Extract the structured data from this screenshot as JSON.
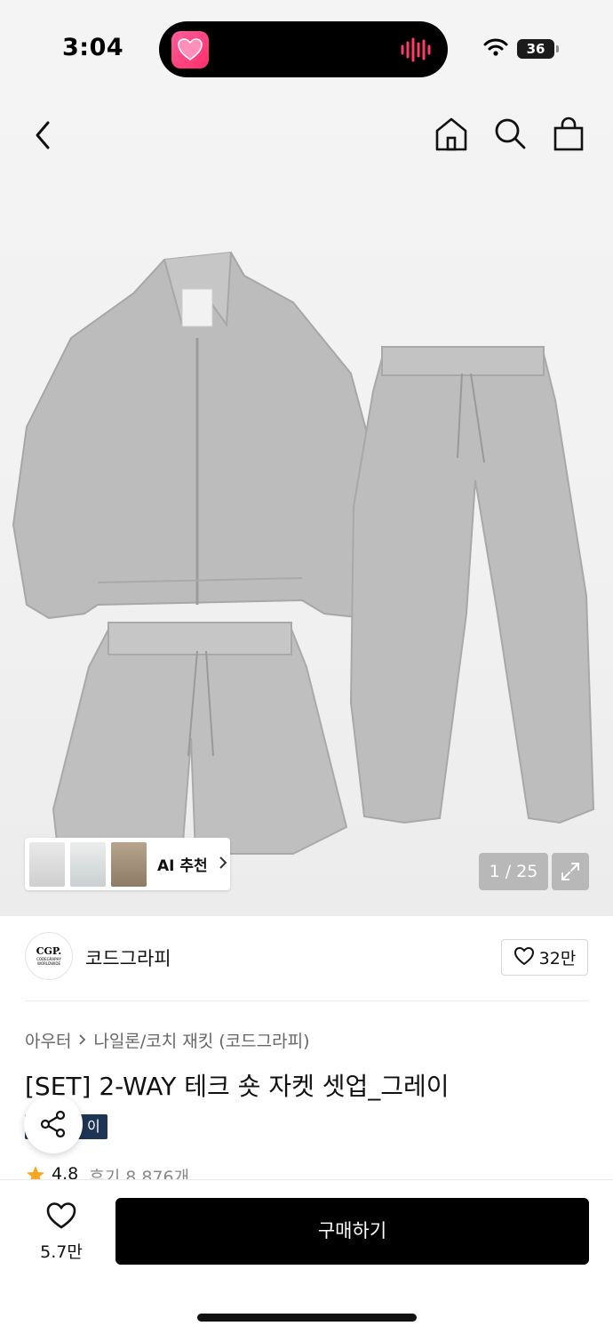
{
  "status_bar": {
    "time": "3:04",
    "battery": "36"
  },
  "image_gallery": {
    "counter": "1 / 25",
    "ai_label": "AI 추천"
  },
  "brand": {
    "logo_text": "CGP.",
    "logo_subtext": "CODEGRAPHY WORLDWIDE",
    "name": "코드그라피",
    "like_count": "32만"
  },
  "product": {
    "breadcrumb": [
      "아우터",
      "나일론/코치 재킷 (코드그라피)"
    ],
    "title": "[SET] 2-WAY 테크 숏 자켓 셋업_그레이",
    "tag": "이",
    "rating": "4.8",
    "review": "후기 8,876개"
  },
  "bottom_bar": {
    "wish_count": "5.7만",
    "buy_label": "구매하기"
  },
  "colors": {
    "accent": "#000000",
    "badge": "#1e3555",
    "star": "#f5a623",
    "garment": "#b9b9b9"
  }
}
